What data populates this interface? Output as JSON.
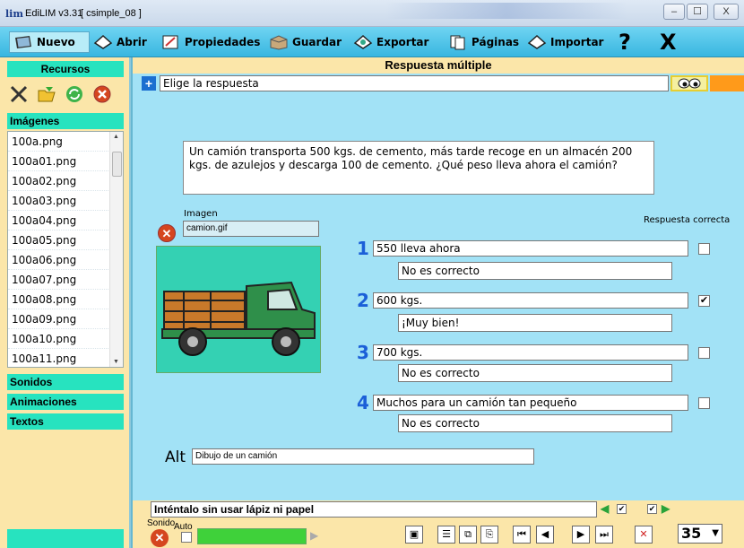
{
  "window": {
    "logo": "lim",
    "title": "EdiLIM  v3.31",
    "doc": "[ csimple_08 ]",
    "controls": [
      "–",
      "☐",
      "X"
    ]
  },
  "toolbar": {
    "nuevo": "Nuevo",
    "abrir": "Abrir",
    "propiedades": "Propiedades",
    "guardar": "Guardar",
    "exportar": "Exportar",
    "paginas": "Páginas",
    "importar": "Importar",
    "help": "?",
    "close": "X"
  },
  "sidebar": {
    "title": "Recursos",
    "categories": {
      "imagenes": "Imágenes",
      "sonidos": "Sonidos",
      "animaciones": "Animaciones",
      "textos": "Textos"
    },
    "files": [
      "100a.png",
      "100a01.png",
      "100a02.png",
      "100a03.png",
      "100a04.png",
      "100a05.png",
      "100a06.png",
      "100a07.png",
      "100a08.png",
      "100a09.png",
      "100a10.png",
      "100a11.png"
    ]
  },
  "main": {
    "header": "Respuesta múltiple",
    "instruction": "Elige la respuesta",
    "question": "Un camión transporta 500 kgs. de cemento, más tarde recoge en un almacén 200 kgs. de azulejos y descarga 100 de cemento. ¿Qué peso lleva ahora el camión?",
    "image_label": "Imagen",
    "image_file": "camion.gif",
    "correct_label": "Respuesta correcta",
    "answers": [
      {
        "num": "1",
        "text": "550 lleva ahora",
        "feedback": "No es correcto",
        "correct": false
      },
      {
        "num": "2",
        "text": "600 kgs.",
        "feedback": "¡Muy bien!",
        "correct": true
      },
      {
        "num": "3",
        "text": "700 kgs.",
        "feedback": "No es correcto",
        "correct": false
      },
      {
        "num": "4",
        "text": "Muchos para un camión tan pequeño",
        "feedback": "No es correcto",
        "correct": false
      }
    ],
    "alt_label": "Alt",
    "alt_text": "Dibujo de un camión"
  },
  "footer": {
    "hint": "Inténtalo sin usar lápiz ni papel",
    "sound_label": "Sonido",
    "auto_label": "Auto",
    "page": "35"
  },
  "colors": {
    "toolbar": "#38b6e0",
    "main_bg": "#a2e2f6",
    "sidebar_bg": "#fbe6a9",
    "accent_cyan": "#27e3bf",
    "answer_num": "#1b5fd8"
  }
}
